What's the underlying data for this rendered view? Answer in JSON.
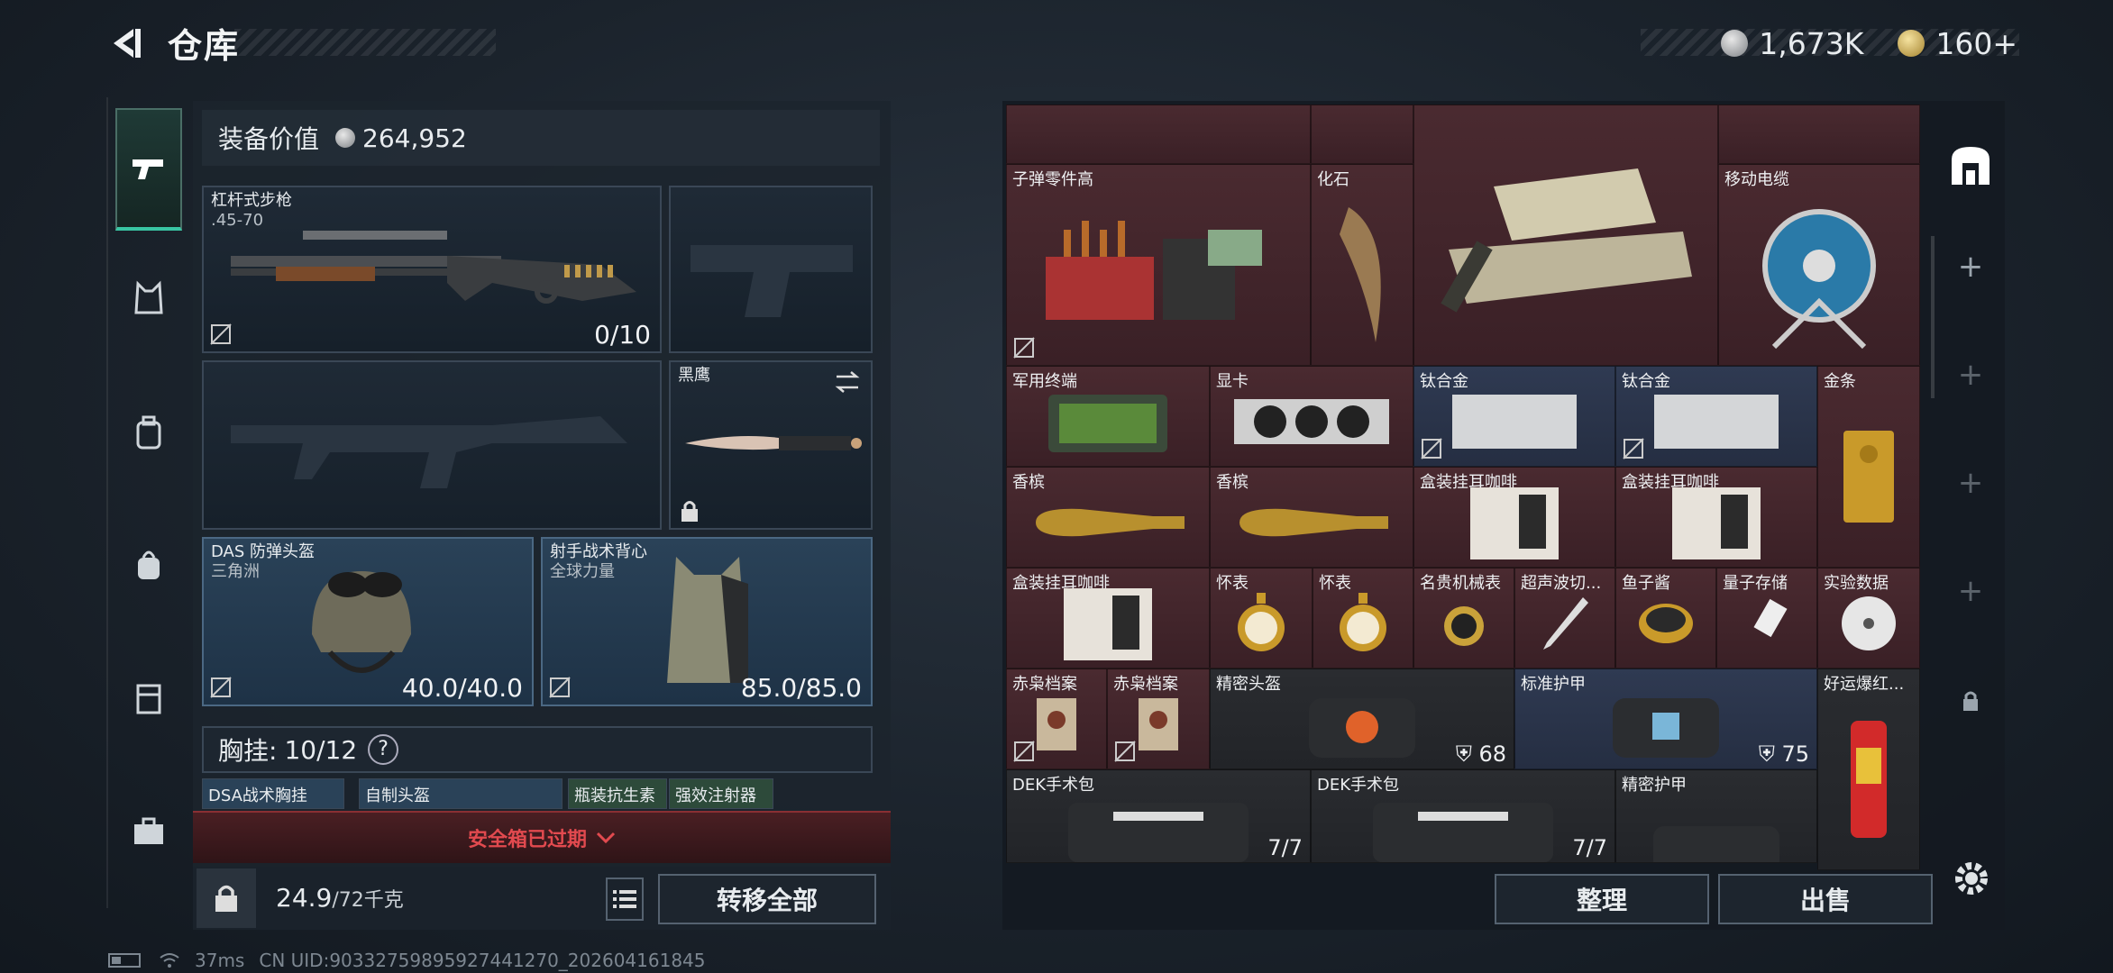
{
  "header": {
    "title": "仓库",
    "silver_amount": "1,673K",
    "gold_amount": "160+"
  },
  "equipment": {
    "value_label": "装备价值",
    "value": "264,952",
    "slots": {
      "rifle": {
        "name": "杠杆式步枪",
        "caliber": ".45-70",
        "count": "0/10"
      },
      "knife": {
        "name": "黑鹰"
      },
      "helmet": {
        "name": "DAS 防弹头盔",
        "sub": "三角洲",
        "durability": "40.0/40.0"
      },
      "vest": {
        "name": "射手战术背心",
        "sub": "全球力量",
        "durability": "85.0/85.0"
      }
    },
    "chest": {
      "label": "胸挂:",
      "count": "10/12",
      "help": "?"
    },
    "mini_slots": [
      "DSA战术胸挂",
      "自制头盔",
      "瓶装抗生素",
      "强效注射器"
    ]
  },
  "safebox": {
    "text": "安全箱已过期"
  },
  "bottom_left": {
    "weight": "24.9",
    "weight_max": "/72千克",
    "transfer_label": "转移全部"
  },
  "grid": {
    "items": [
      {
        "label": "子弹零件高"
      },
      {
        "label": "化石"
      },
      {
        "label": "移动电缆"
      },
      {
        "label": "军用终端"
      },
      {
        "label": "显卡"
      },
      {
        "label": "钛合金"
      },
      {
        "label": "钛合金"
      },
      {
        "label": "金条"
      },
      {
        "label": "香槟"
      },
      {
        "label": "香槟"
      },
      {
        "label": "盒装挂耳咖啡"
      },
      {
        "label": "盒装挂耳咖啡"
      },
      {
        "label": "盒装挂耳咖啡"
      },
      {
        "label": "怀表"
      },
      {
        "label": "怀表"
      },
      {
        "label": "名贵机械表"
      },
      {
        "label": "超声波切..."
      },
      {
        "label": "鱼子酱"
      },
      {
        "label": "量子存储"
      },
      {
        "label": "实验数据"
      },
      {
        "label": "赤枭档案"
      },
      {
        "label": "赤枭档案"
      },
      {
        "label": "精密头盔",
        "armor": "68"
      },
      {
        "label": "标准护甲",
        "armor": "75"
      },
      {
        "label": "好运爆红..."
      },
      {
        "label": "DEK手术包",
        "count": "7/7"
      },
      {
        "label": "DEK手术包",
        "count": "7/7"
      },
      {
        "label": "精密护甲"
      }
    ]
  },
  "actions": {
    "sort_label": "整理",
    "sell_label": "出售"
  },
  "status": {
    "ping": "37ms",
    "uid": "CN UID:90332759895927441270_202604161845"
  },
  "colors": {
    "accent": "#39c5a3",
    "warning": "#e24a4f"
  }
}
